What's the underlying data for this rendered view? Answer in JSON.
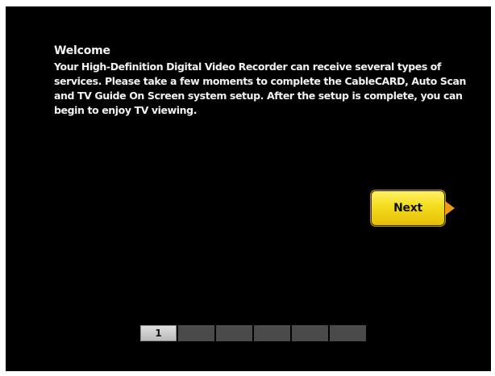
{
  "welcome": {
    "title": "Welcome",
    "body": "Your High-Definition Digital Video Recorder can receive several types of services. Please take a few moments to complete the CableCARD, Auto Scan and TV Guide On Screen system setup. After the setup is complete, you can begin to enjoy TV viewing."
  },
  "next_button": {
    "label": "Next",
    "arrow_icon": "play-arrow-right"
  },
  "progress": {
    "current_step_label": "1",
    "current_step": 1,
    "total_steps": 6
  },
  "colors": {
    "screen_background": "#000000",
    "text": "#f2f2f2",
    "button_yellow": "#f4dd1c",
    "arrow_orange": "#f09a16",
    "step_inactive": "#4a4a4a",
    "step_active": "#cfcfcf"
  }
}
